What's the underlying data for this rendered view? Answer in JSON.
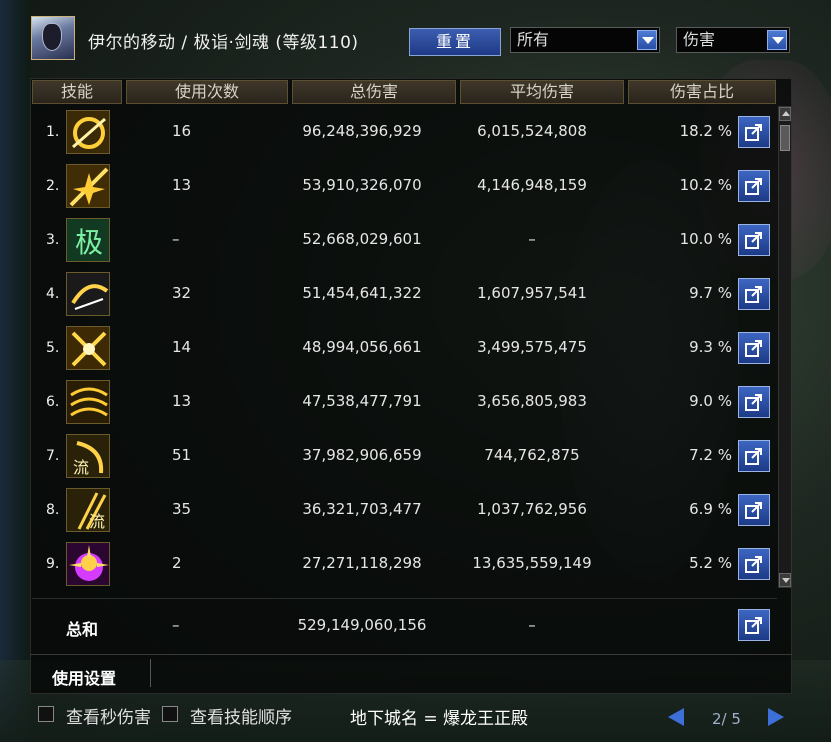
{
  "header": {
    "title": "伊尔的移动 / 极诣·剑魂 (等级110)",
    "reset_label": "重置",
    "filter_all": "所有",
    "filter_metric": "伤害"
  },
  "columns": {
    "skill": "技能",
    "uses": "使用次数",
    "total": "总伤害",
    "avg": "平均伤害",
    "ratio": "伤害占比"
  },
  "rows": [
    {
      "rank": "1.",
      "uses": "16",
      "total": "96,248,396,929",
      "avg": "6,015,524,808",
      "ratio": "18.2 %",
      "icon": "sword-slash-swirl-icon"
    },
    {
      "rank": "2.",
      "uses": "13",
      "total": "53,910,326,070",
      "avg": "4,146,948,159",
      "ratio": "10.2 %",
      "icon": "sword-burst-icon"
    },
    {
      "rank": "3.",
      "uses": "–",
      "total": "52,668,029,601",
      "avg": "–",
      "ratio": "10.0 %",
      "icon": "green-glyph-icon",
      "glyph": "极"
    },
    {
      "rank": "4.",
      "uses": "32",
      "total": "51,454,641,322",
      "avg": "1,607,957,541",
      "ratio": "9.7 %",
      "icon": "sword-arc-icon"
    },
    {
      "rank": "5.",
      "uses": "14",
      "total": "48,994,056,661",
      "avg": "3,499,575,475",
      "ratio": "9.3 %",
      "icon": "crossed-blade-icon"
    },
    {
      "rank": "6.",
      "uses": "13",
      "total": "47,538,477,791",
      "avg": "3,656,805,983",
      "ratio": "9.0 %",
      "icon": "wave-slash-icon"
    },
    {
      "rank": "7.",
      "uses": "51",
      "total": "37,982,906,659",
      "avg": "744,762,875",
      "ratio": "7.2 %",
      "icon": "flow-slash-icon",
      "glyph": "流"
    },
    {
      "rank": "8.",
      "uses": "35",
      "total": "36,321,703,477",
      "avg": "1,037,762,956",
      "ratio": "6.9 %",
      "icon": "flow-strike-icon",
      "glyph": "流"
    },
    {
      "rank": "9.",
      "uses": "2",
      "total": "27,271,118,298",
      "avg": "13,635,559,149",
      "ratio": "5.2 %",
      "icon": "purple-explosion-icon"
    }
  ],
  "totals": {
    "label": "总和",
    "uses": "–",
    "total": "529,149,060,156",
    "avg": "–"
  },
  "settings": {
    "tab_label": "使用设置"
  },
  "bottom": {
    "check_dps": "查看秒伤害",
    "check_order": "查看技能顺序",
    "dungeon": "地下城名 = 爆龙王正殿",
    "page": "2/ 5"
  }
}
